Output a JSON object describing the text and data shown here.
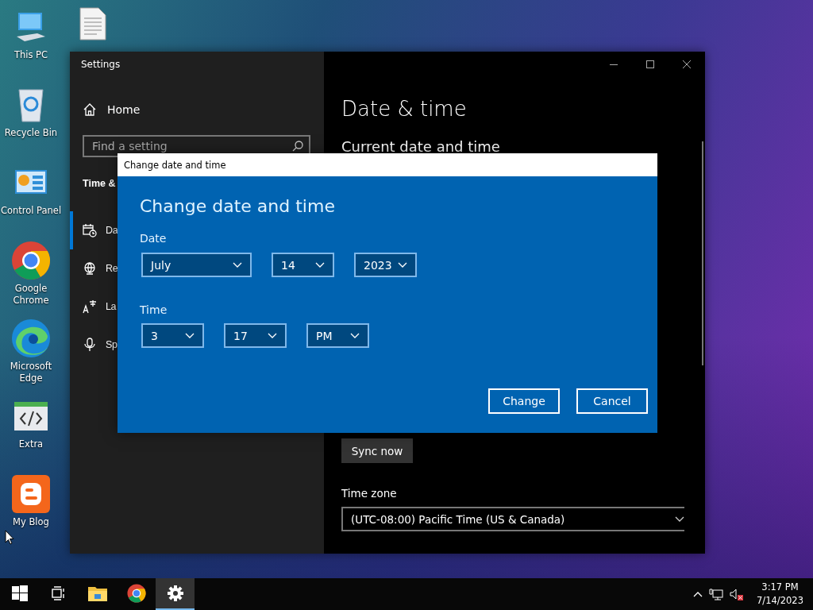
{
  "desktop_icons": [
    {
      "label": "This PC",
      "kind": "pc"
    },
    {
      "label": "Recycle Bin",
      "kind": "bin"
    },
    {
      "label": "Control Panel",
      "kind": "panel"
    },
    {
      "label": "Google Chrome",
      "kind": "chrome"
    },
    {
      "label": "Microsoft Edge",
      "kind": "edge"
    },
    {
      "label": "Extra",
      "kind": "code"
    },
    {
      "label": "My Blog",
      "kind": "blog"
    }
  ],
  "settings_window": {
    "title": "Settings",
    "home": "Home",
    "search": {
      "placeholder": "Find a setting"
    },
    "section": "Time &",
    "nav_items": [
      {
        "label": "Da",
        "kind": "calendar",
        "selected": true
      },
      {
        "label": "Re",
        "kind": "globe",
        "selected": false
      },
      {
        "label": "La",
        "kind": "language",
        "selected": false
      },
      {
        "label": "Sp",
        "kind": "mic",
        "selected": false
      }
    ],
    "page_title": "Date & time",
    "subheading": "Current date and time",
    "sync_button": "Sync now",
    "time_zone_label": "Time zone",
    "time_zone": "(UTC-08:00) Pacific Time (US & Canada)"
  },
  "dialog": {
    "title": "Change date and time",
    "heading": "Change date and time",
    "date_label": "Date",
    "date_fields": [
      {
        "value": "July",
        "kind": "wide"
      },
      {
        "value": "14",
        "kind": "narrow"
      },
      {
        "value": "2023",
        "kind": "narrow"
      }
    ],
    "time_label": "Time",
    "time_fields": [
      {
        "value": "3",
        "kind": "narrow"
      },
      {
        "value": "17",
        "kind": "narrow"
      },
      {
        "value": "PM",
        "kind": "narrow"
      }
    ],
    "buttons": [
      "Change",
      "Cancel"
    ]
  },
  "taskbar": {
    "apps": [
      {
        "kind": "start",
        "active": false
      },
      {
        "kind": "taskview",
        "active": false
      },
      {
        "kind": "folder",
        "active": false
      },
      {
        "kind": "chrome",
        "active": false
      },
      {
        "kind": "settings",
        "active": true
      }
    ],
    "clock": {
      "time": "3:17 PM",
      "date": "7/14/2023"
    }
  }
}
